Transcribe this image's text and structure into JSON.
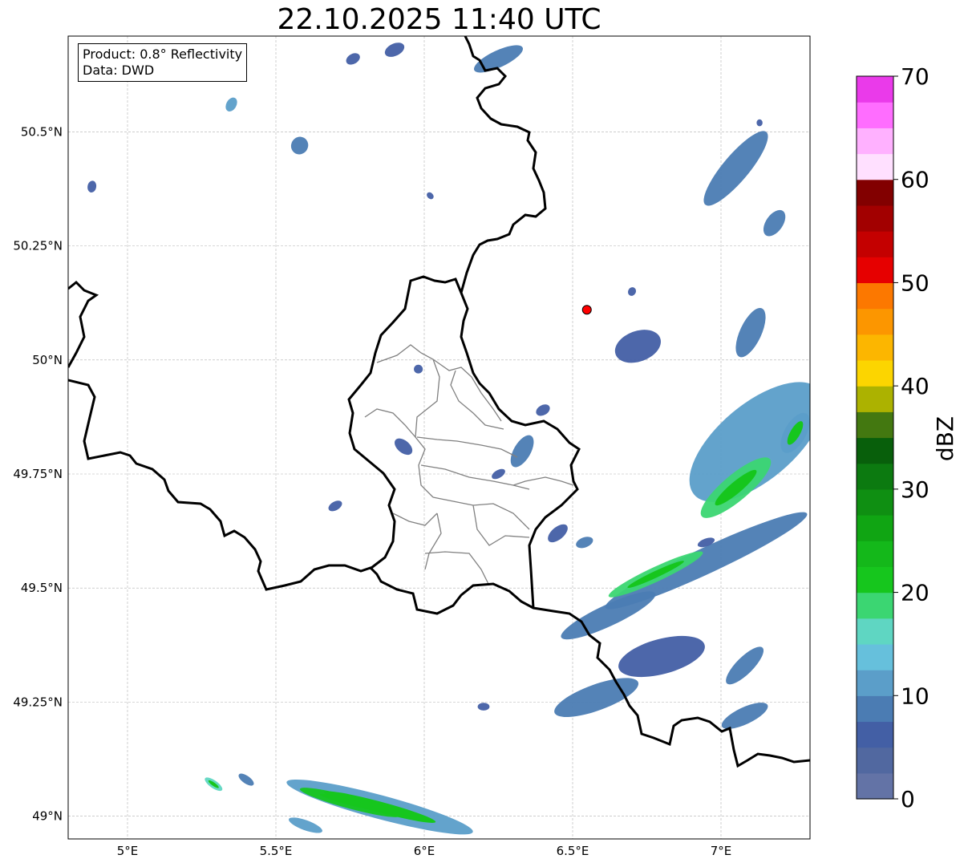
{
  "title": "22.10.2025 11:40 UTC",
  "info": {
    "product": "Product: 0.8° Reflectivity",
    "data": "Data: DWD"
  },
  "axes": {
    "lon_range": [
      4.8,
      7.3
    ],
    "lat_range": [
      48.95,
      50.71
    ],
    "x_ticks": [
      {
        "value": 5.0,
        "label": "5°E"
      },
      {
        "value": 5.5,
        "label": "5.5°E"
      },
      {
        "value": 6.0,
        "label": "6°E"
      },
      {
        "value": 6.5,
        "label": "6.5°E"
      },
      {
        "value": 7.0,
        "label": "7°E"
      }
    ],
    "y_ticks": [
      {
        "value": 49.0,
        "label": "49°N"
      },
      {
        "value": 49.25,
        "label": "49.25°N"
      },
      {
        "value": 49.5,
        "label": "49.5°N"
      },
      {
        "value": 49.75,
        "label": "49.75°N"
      },
      {
        "value": 50.0,
        "label": "50°N"
      },
      {
        "value": 50.25,
        "label": "50.25°N"
      },
      {
        "value": 50.5,
        "label": "50.5°N"
      }
    ],
    "grid": true
  },
  "colorbar": {
    "label": "dBZ",
    "min": 0,
    "max": 70,
    "ticks": [
      {
        "value": 0,
        "label": "0"
      },
      {
        "value": 10,
        "label": "10"
      },
      {
        "value": 20,
        "label": "20"
      },
      {
        "value": 30,
        "label": "30"
      },
      {
        "value": 40,
        "label": "40"
      },
      {
        "value": 50,
        "label": "50"
      },
      {
        "value": 60,
        "label": "60"
      },
      {
        "value": 70,
        "label": "70"
      }
    ],
    "colors": [
      "#6373a6",
      "#5168a0",
      "#435fa5",
      "#4b7cb3",
      "#5b9ec9",
      "#66c0dc",
      "#5fd6c2",
      "#3bd672",
      "#16c61d",
      "#14b81a",
      "#10a513",
      "#0f8f12",
      "#0c7a10",
      "#085f0b",
      "#437810",
      "#acb200",
      "#fcd500",
      "#fcb600",
      "#fc9600",
      "#fc7800",
      "#e60000",
      "#c40000",
      "#a20000",
      "#820000",
      "#ffe0ff",
      "#ffb1ff",
      "#ff6dff",
      "#ea3aea"
    ]
  },
  "radar_marker": {
    "lon": 6.548,
    "lat": 50.11,
    "color": "#ff0000"
  },
  "echoes": [
    {
      "lon": 6.25,
      "lat": 50.66,
      "len": 0.18,
      "wid": 0.03,
      "ang": 25,
      "dbz": 8
    },
    {
      "lon": 5.76,
      "lat": 50.66,
      "len": 0.05,
      "wid": 0.015,
      "ang": 30,
      "dbz": 6
    },
    {
      "lon": 5.9,
      "lat": 50.68,
      "len": 0.07,
      "wid": 0.02,
      "ang": 25,
      "dbz": 7
    },
    {
      "lon": 5.35,
      "lat": 50.56,
      "len": 0.05,
      "wid": 0.015,
      "ang": 60,
      "dbz": 10
    },
    {
      "lon": 5.58,
      "lat": 50.47,
      "len": 0.06,
      "wid": 0.03,
      "ang": 60,
      "dbz": 9
    },
    {
      "lon": 4.88,
      "lat": 50.38,
      "len": 0.04,
      "wid": 0.012,
      "ang": 80,
      "dbz": 6
    },
    {
      "lon": 7.05,
      "lat": 50.42,
      "len": 0.32,
      "wid": 0.05,
      "ang": 50,
      "dbz": 8
    },
    {
      "lon": 7.18,
      "lat": 50.3,
      "len": 0.1,
      "wid": 0.03,
      "ang": 55,
      "dbz": 9
    },
    {
      "lon": 6.72,
      "lat": 50.03,
      "len": 0.16,
      "wid": 0.06,
      "ang": 20,
      "dbz": 7
    },
    {
      "lon": 7.1,
      "lat": 50.06,
      "len": 0.18,
      "wid": 0.04,
      "ang": 65,
      "dbz": 9
    },
    {
      "lon": 7.12,
      "lat": 49.82,
      "len": 0.55,
      "wid": 0.16,
      "ang": 40,
      "dbz": 11
    },
    {
      "lon": 7.05,
      "lat": 49.72,
      "len": 0.3,
      "wid": 0.05,
      "ang": 40,
      "dbz": 18
    },
    {
      "lon": 6.95,
      "lat": 49.56,
      "len": 0.75,
      "wid": 0.05,
      "ang": 25,
      "dbz": 9
    },
    {
      "lon": 6.78,
      "lat": 49.53,
      "len": 0.35,
      "wid": 0.025,
      "ang": 25,
      "dbz": 19
    },
    {
      "lon": 6.62,
      "lat": 49.44,
      "len": 0.35,
      "wid": 0.04,
      "ang": 25,
      "dbz": 8
    },
    {
      "lon": 6.8,
      "lat": 49.35,
      "len": 0.3,
      "wid": 0.07,
      "ang": 15,
      "dbz": 7
    },
    {
      "lon": 6.58,
      "lat": 49.26,
      "len": 0.3,
      "wid": 0.05,
      "ang": 20,
      "dbz": 8
    },
    {
      "lon": 7.08,
      "lat": 49.33,
      "len": 0.17,
      "wid": 0.03,
      "ang": 45,
      "dbz": 9
    },
    {
      "lon": 7.08,
      "lat": 49.22,
      "len": 0.17,
      "wid": 0.03,
      "ang": 25,
      "dbz": 9
    },
    {
      "lon": 6.33,
      "lat": 49.8,
      "len": 0.12,
      "wid": 0.03,
      "ang": 60,
      "dbz": 8
    },
    {
      "lon": 6.4,
      "lat": 49.89,
      "len": 0.05,
      "wid": 0.015,
      "ang": 30,
      "dbz": 6
    },
    {
      "lon": 6.45,
      "lat": 49.62,
      "len": 0.08,
      "wid": 0.02,
      "ang": 40,
      "dbz": 7
    },
    {
      "lon": 6.54,
      "lat": 49.6,
      "len": 0.06,
      "wid": 0.015,
      "ang": 20,
      "dbz": 8
    },
    {
      "lon": 6.25,
      "lat": 49.75,
      "len": 0.05,
      "wid": 0.01,
      "ang": 30,
      "dbz": 6
    },
    {
      "lon": 5.93,
      "lat": 49.81,
      "len": 0.07,
      "wid": 0.02,
      "ang": -40,
      "dbz": 7
    },
    {
      "lon": 5.98,
      "lat": 49.98,
      "len": 0.03,
      "wid": 0.012,
      "ang": 0,
      "dbz": 6
    },
    {
      "lon": 5.7,
      "lat": 49.68,
      "len": 0.05,
      "wid": 0.012,
      "ang": 30,
      "dbz": 6
    },
    {
      "lon": 6.2,
      "lat": 49.24,
      "len": 0.04,
      "wid": 0.01,
      "ang": 0,
      "dbz": 6
    },
    {
      "lon": 6.95,
      "lat": 49.6,
      "len": 0.06,
      "wid": 0.01,
      "ang": 20,
      "dbz": 6
    },
    {
      "lon": 7.25,
      "lat": 49.84,
      "len": 0.15,
      "wid": 0.04,
      "ang": 60,
      "dbz": 12
    },
    {
      "lon": 5.85,
      "lat": 49.02,
      "len": 0.65,
      "wid": 0.045,
      "ang": -15,
      "dbz": 12
    },
    {
      "lon": 5.75,
      "lat": 49.03,
      "len": 0.35,
      "wid": 0.02,
      "ang": -15,
      "dbz": 22
    },
    {
      "lon": 5.6,
      "lat": 48.98,
      "len": 0.12,
      "wid": 0.015,
      "ang": -20,
      "dbz": 10
    },
    {
      "lon": 5.29,
      "lat": 49.07,
      "len": 0.07,
      "wid": 0.01,
      "ang": -35,
      "dbz": 15
    },
    {
      "lon": 5.4,
      "lat": 49.08,
      "len": 0.06,
      "wid": 0.01,
      "ang": -35,
      "dbz": 8
    },
    {
      "lon": 6.7,
      "lat": 50.15,
      "len": 0.03,
      "wid": 0.01,
      "ang": 60,
      "dbz": 6
    },
    {
      "lon": 6.02,
      "lat": 50.36,
      "len": 0.02,
      "wid": 0.01,
      "ang": 45,
      "dbz": 6
    },
    {
      "lon": 7.13,
      "lat": 50.52,
      "len": 0.02,
      "wid": 0.008,
      "ang": 0,
      "dbz": 6
    }
  ]
}
